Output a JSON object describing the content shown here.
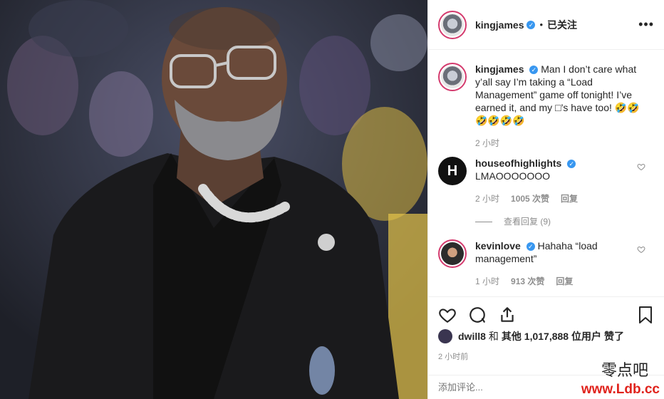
{
  "post": {
    "author": "kingjames",
    "follow_status": "已关注",
    "more_icon": "ellipsis-icon"
  },
  "caption": {
    "user": "kingjames",
    "text": "Man I don’t care what y’all say I’m taking a “Load Management” game off tonight! I’ve earned it, and my □’s have too! 🤣🤣 🤣🤣🤣🤣",
    "time": "2 小时"
  },
  "comments": [
    {
      "user": "houseofhighlights",
      "text": "LMAOOOOOOO",
      "time": "2 小时",
      "likes": "1005 次赞",
      "reply": "回复",
      "view_replies": "查看回复 (9)"
    },
    {
      "user": "kevinlove",
      "text": "Hahaha “load management”",
      "time": "1 小时",
      "likes": "913 次赞",
      "reply": "回复"
    }
  ],
  "likes_line": {
    "liker": "dwill8",
    "and": "和",
    "others": "其他 1,017,888 位用户",
    "suffix": "赞了"
  },
  "timestamp": "2 小时前",
  "comment_input": {
    "placeholder": "添加评论..."
  },
  "watermark": {
    "line1": "零点吧",
    "line2": "www.Ldb.cc"
  },
  "colors": {
    "verified": "#3897f0",
    "meta": "#8e8e8e",
    "text": "#262626",
    "story_ring": "#d43b6e"
  }
}
